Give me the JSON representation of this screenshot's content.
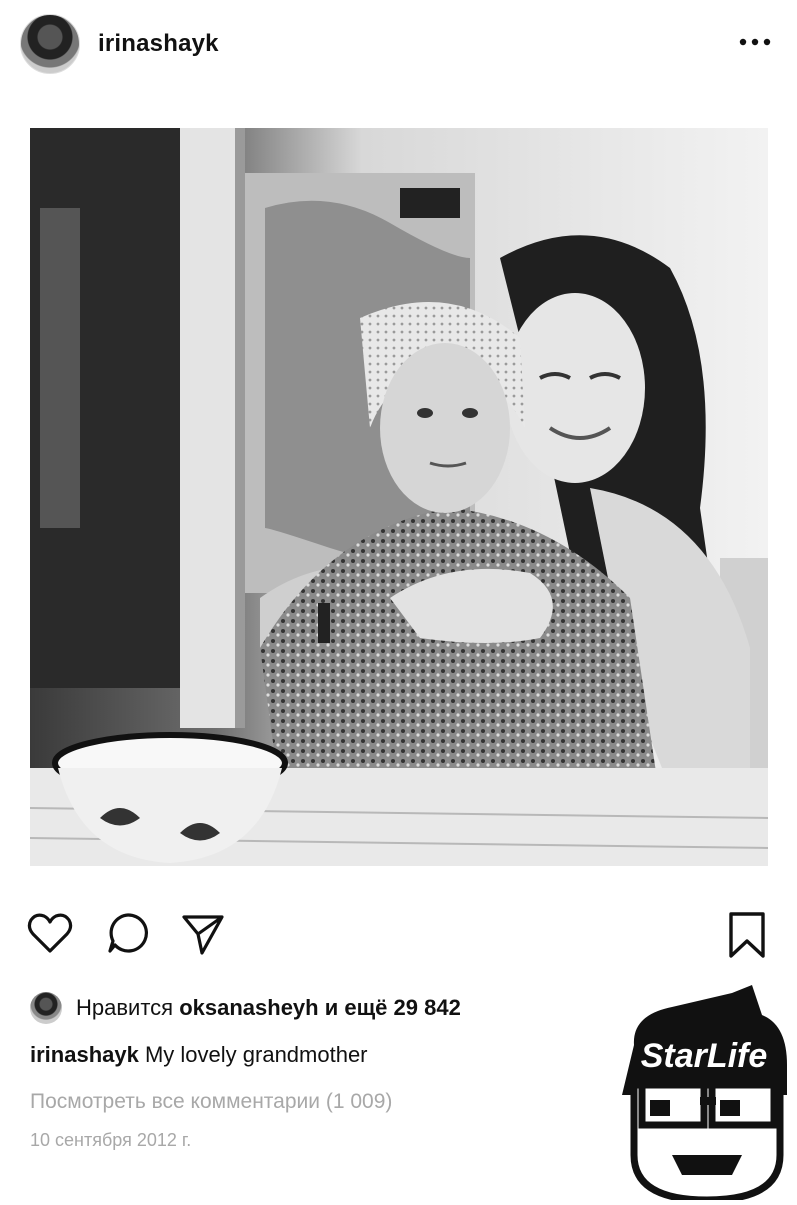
{
  "post": {
    "username": "irinashayk",
    "more_icon": "more-horizontal-icon",
    "photo_description_icon": "photo",
    "actions": {
      "like_icon": "heart-icon",
      "comment_icon": "comment-icon",
      "share_icon": "send-icon",
      "save_icon": "bookmark-icon"
    },
    "likes": {
      "prefix": "Нравится",
      "user": "oksanasheyh",
      "suffix": "и ещё 29 842"
    },
    "caption": {
      "user": "irinashayk",
      "text": "My lovely grandmother"
    },
    "view_comments": "Посмотреть все комментарии (1 009)",
    "date": "10 сентября 2012 г."
  },
  "watermark": {
    "text": "StarLife"
  },
  "colors": {
    "text": "#111111",
    "muted": "#a8a8a8",
    "background": "#ffffff"
  }
}
